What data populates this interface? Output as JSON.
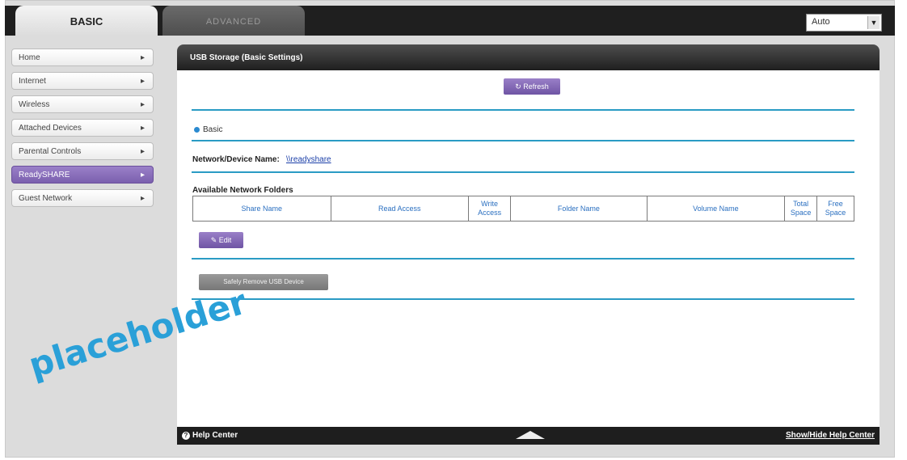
{
  "tabs": {
    "basic": "BASIC",
    "advanced": "ADVANCED"
  },
  "language": {
    "selected": "Auto"
  },
  "sidebar": {
    "items": [
      {
        "label": "Home"
      },
      {
        "label": "Internet"
      },
      {
        "label": "Wireless"
      },
      {
        "label": "Attached Devices"
      },
      {
        "label": "Parental Controls"
      },
      {
        "label": "ReadySHARE",
        "active": true
      },
      {
        "label": "Guest Network"
      }
    ]
  },
  "panel": {
    "title": "USB Storage (Basic Settings)",
    "refresh_label": "Refresh",
    "radio_basic": "Basic",
    "network_device_name_label": "Network/Device Name:",
    "network_device_name_value": "\\\\readyshare",
    "folders_title": "Available Network Folders",
    "columns": [
      "Share Name",
      "Read Access",
      "Write Access",
      "Folder Name",
      "Volume Name",
      "Total Space",
      "Free Space"
    ],
    "edit_label": "Edit",
    "safe_remove_label": "Safely Remove USB Device"
  },
  "footer": {
    "help_center": "Help Center",
    "toggle": "Show/Hide Help Center"
  },
  "watermark": "placeholder",
  "colors": {
    "accent": "#2a9bc4",
    "purple": "#7b60ae"
  }
}
